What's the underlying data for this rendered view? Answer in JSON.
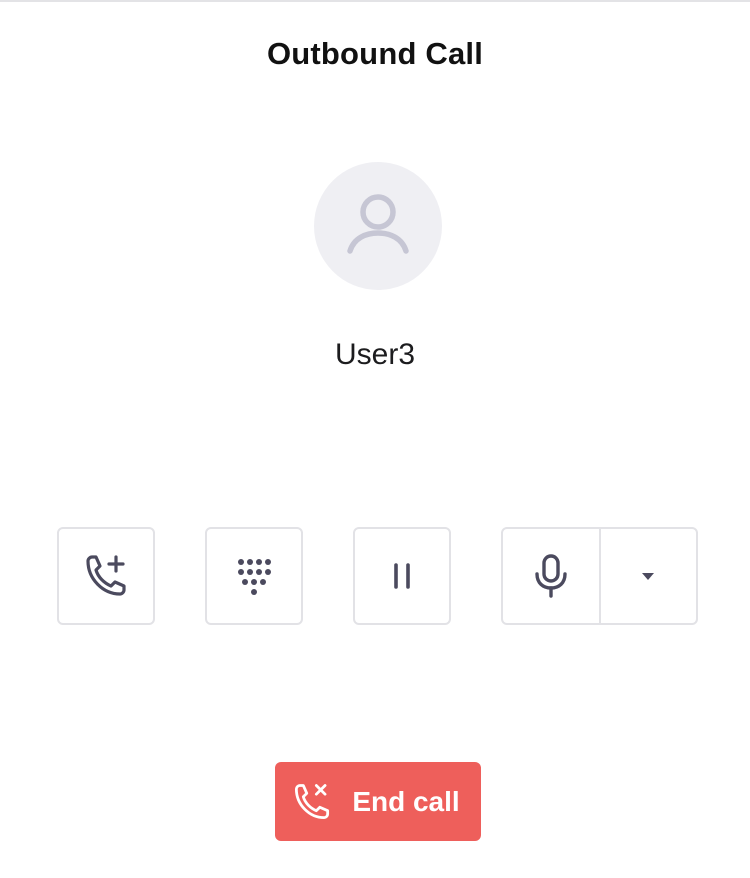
{
  "header": {
    "title": "Outbound Call"
  },
  "contact": {
    "name": "User3",
    "avatar_icon": "user-icon"
  },
  "controls": [
    {
      "name": "add-call-button",
      "icon": "phone-plus-icon"
    },
    {
      "name": "keypad-button",
      "icon": "dialpad-icon"
    },
    {
      "name": "hold-button",
      "icon": "pause-icon"
    },
    {
      "name": "mute-button",
      "icon": "microphone-icon"
    },
    {
      "name": "audio-options-dropdown",
      "icon": "caret-down-icon"
    }
  ],
  "end_call": {
    "label": "End call",
    "icon": "phone-hangup-icon",
    "color": "#ee5f5b"
  },
  "colors": {
    "icon": "#4b4a5e",
    "avatar_bg": "#efeff3",
    "avatar_icon": "#c6c6d4",
    "border": "#e2e2e6"
  }
}
